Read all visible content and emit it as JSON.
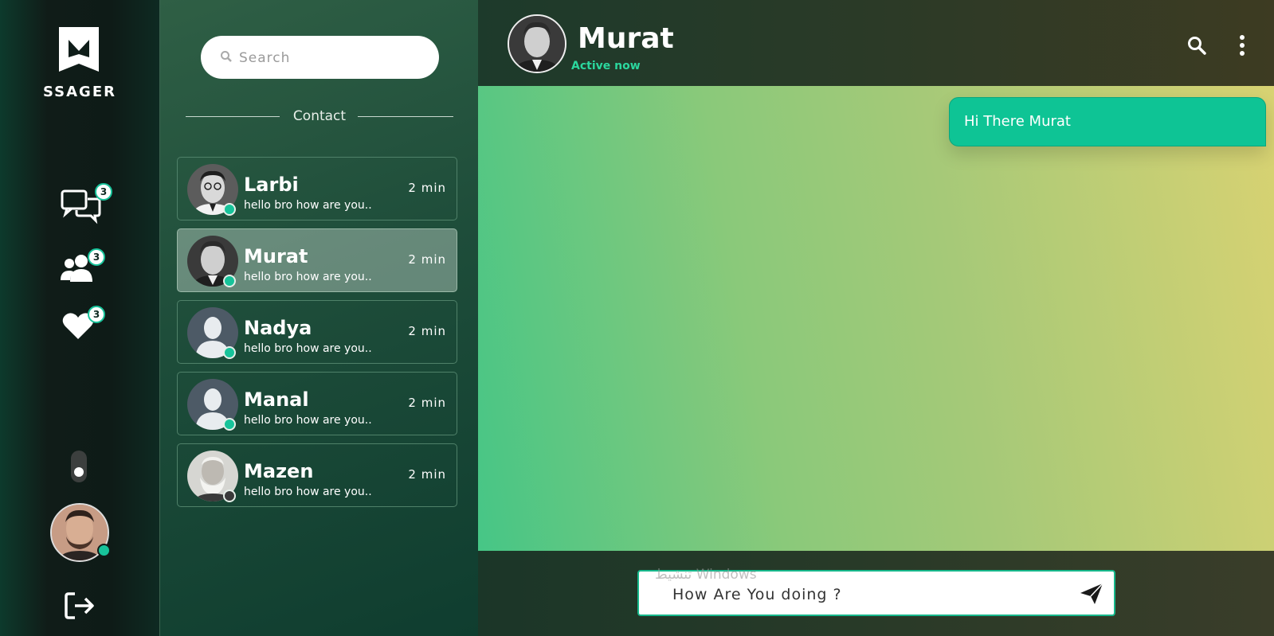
{
  "brand": {
    "name": "SSAGER"
  },
  "rail": {
    "items": [
      {
        "icon": "chats-icon",
        "badge": "3"
      },
      {
        "icon": "users-icon",
        "badge": "3"
      },
      {
        "icon": "heart-icon",
        "badge": "3"
      }
    ]
  },
  "contacts_panel": {
    "search_placeholder": "Search",
    "section_title": "Contact",
    "contacts": [
      {
        "name": "Larbi",
        "time": "2 min",
        "preview": "hello bro how are you...",
        "online": true,
        "active": false
      },
      {
        "name": "Murat",
        "time": "2 min",
        "preview": "hello bro how are you...",
        "online": true,
        "active": true
      },
      {
        "name": "Nadya",
        "time": "2 min",
        "preview": "hello bro how are you...",
        "online": true,
        "active": false
      },
      {
        "name": "Manal",
        "time": "2 min",
        "preview": "hello bro how are you...",
        "online": true,
        "active": false
      },
      {
        "name": "Mazen",
        "time": "2 min",
        "preview": "hello bro how are you...",
        "online": false,
        "active": false
      }
    ]
  },
  "chat": {
    "name": "Murat",
    "status": "Active now",
    "messages": [
      {
        "text": "Hi There Murat",
        "from": "me"
      }
    ],
    "composer_value": "How Are You doing ?"
  },
  "watermark": "تنشيط Windows",
  "colors": {
    "accent": "#0ec495",
    "online": "#17c39a",
    "offline": "#3a3a3a"
  }
}
